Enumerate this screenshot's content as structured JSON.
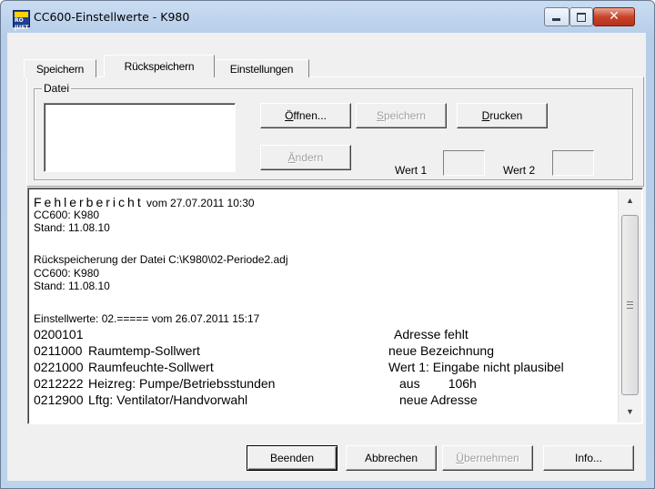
{
  "window": {
    "title": "CC600-Einstellwerte - K980",
    "icon_text": "RO JUST"
  },
  "window_controls": {
    "minimize": "minimize-icon",
    "maximize": "maximize-icon",
    "close": "close-icon",
    "close_glyph": "✕"
  },
  "tabs": [
    {
      "label": "Speichern",
      "active": false
    },
    {
      "label": "Rückspeichern",
      "active": true
    },
    {
      "label": "Einstellungen",
      "active": false
    }
  ],
  "datei": {
    "group_label": "Datei",
    "open_pre": "",
    "open_u": "Ö",
    "open_post": "ffnen...",
    "save_pre": "",
    "save_u": "S",
    "save_post": "peichern",
    "print_pre": "",
    "print_u": "D",
    "print_post": "rucken",
    "change_pre": "",
    "change_u": "Ä",
    "change_post": "ndern",
    "wert1_label": "Wert 1",
    "wert2_label": "Wert 2"
  },
  "report": {
    "heading": "Fehlerbericht",
    "heading_rest": " vom 27.07.2011 10:30",
    "lines_a": [
      "CC600: K980",
      "Stand: 11.08.10"
    ],
    "lines_b": [
      "Rückspeicherung der Datei C:\\K980\\02-Periode2.adj",
      "CC600: K980",
      "Stand: 11.08.10"
    ],
    "einstell_line": "Einstellwerte: 02.===== vom 26.07.2011 15:17",
    "rows": [
      {
        "code": "0200101",
        "name": "",
        "status": "Adresse fehlt"
      },
      {
        "code": "0211000",
        "name": "Raumtemp-Sollwert",
        "status": "neue Bezeichnung"
      },
      {
        "code": "0221000",
        "name": "Raumfeuchte-Sollwert",
        "status": "Wert 1: Eingabe nicht plausibel"
      },
      {
        "code": "0212222",
        "name": "Heizreg: Pumpe/Betriebsstunden",
        "status": "aus        106h"
      },
      {
        "code": "0212900",
        "name": "Lftg: Ventilator/Handvorwahl",
        "status": "neue Adresse"
      }
    ]
  },
  "scrollbar": {
    "up_icon": "▲",
    "down_icon": "▼"
  },
  "bottom": {
    "quit": "Beenden",
    "cancel": "Abbrechen",
    "apply_pre": "",
    "apply_u": "Ü",
    "apply_post": "bernehmen",
    "info": "Info..."
  },
  "colors": {
    "title_bar": "#c9dcf1",
    "close_button": "#c8442a",
    "dialog_bg": "#f0f0f0"
  }
}
